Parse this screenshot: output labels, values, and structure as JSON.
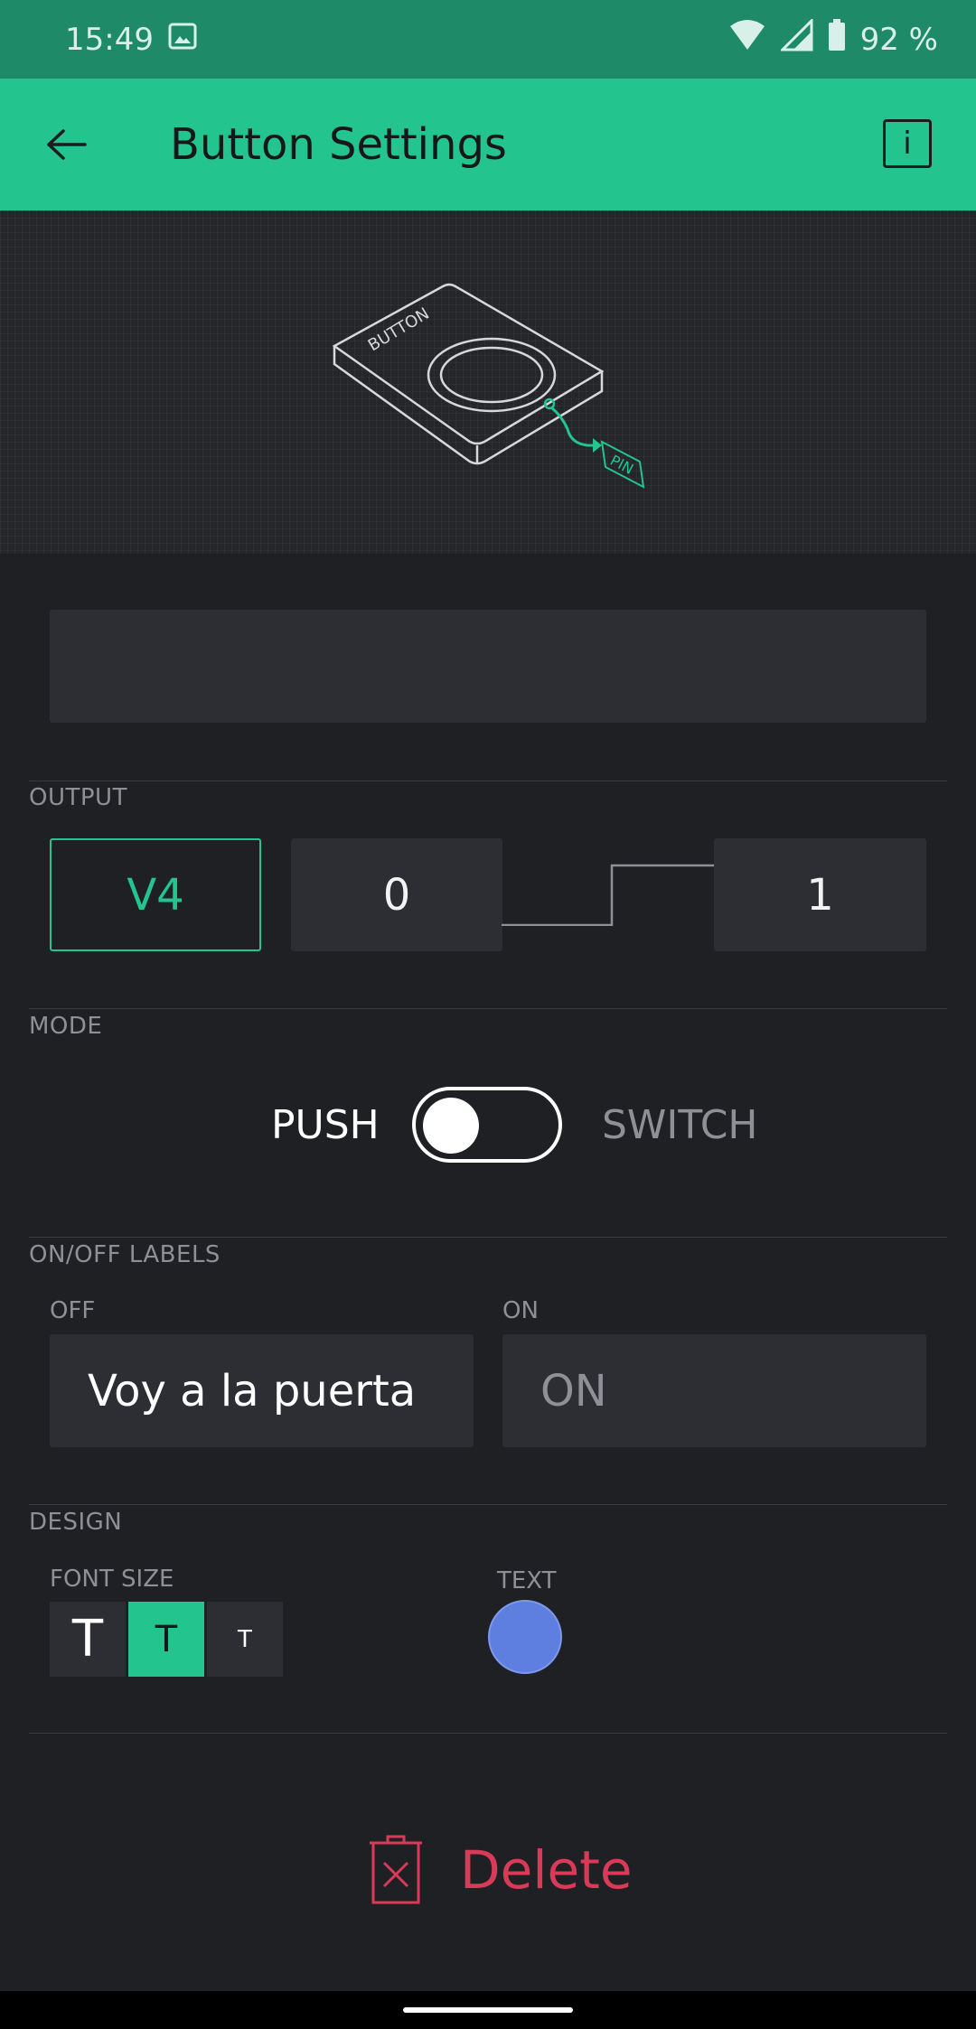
{
  "status_bar": {
    "time": "15:49",
    "gallery_icon": "image-icon",
    "wifi_icon": "wifi-icon",
    "signal_icon": "signal-icon",
    "battery_icon": "battery-icon",
    "battery": "92 %"
  },
  "app_bar": {
    "back_icon": "arrow-left-icon",
    "title": "Button Settings",
    "info_label": "i"
  },
  "preview": {
    "device_label": "BUTTON",
    "pin_label": "PIN"
  },
  "name_field": {
    "value": "",
    "placeholder": ""
  },
  "output": {
    "section_label": "OUTPUT",
    "pin": "V4",
    "low_value": "0",
    "high_value": "1"
  },
  "mode": {
    "section_label": "MODE",
    "push_label": "PUSH",
    "switch_label": "SWITCH",
    "selected": "PUSH"
  },
  "labels": {
    "section_label": "ON/OFF LABELS",
    "off_label": "OFF",
    "off_value": "Voy a la puerta",
    "on_label": "ON",
    "on_placeholder": "ON"
  },
  "design": {
    "section_label": "DESIGN",
    "font_size_label": "FONT SIZE",
    "font_sizes": [
      "T",
      "T",
      "T"
    ],
    "selected_font_size_index": 1,
    "text_label": "TEXT",
    "text_color": "#5f7fe0"
  },
  "delete": {
    "label": "Delete",
    "icon": "trash-icon"
  },
  "colors": {
    "accent": "#23c48e",
    "background": "#1f2024",
    "field": "#2d2e33",
    "danger": "#d83a57"
  }
}
